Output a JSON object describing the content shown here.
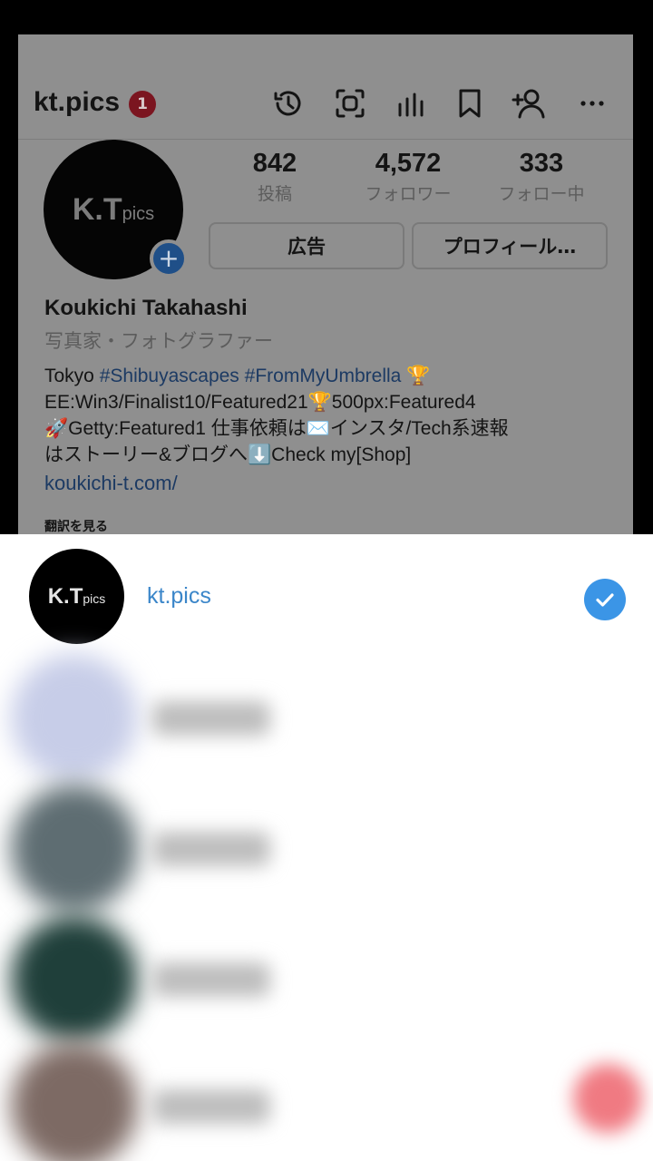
{
  "profile": {
    "username": "kt.pics",
    "notification_count": "1",
    "avatar_logo": {
      "main": "K.T",
      "sub": "pics"
    },
    "add_story_symbol": "+",
    "stats": [
      {
        "value": "842",
        "label": "投稿"
      },
      {
        "value": "4,572",
        "label": "フォロワー"
      },
      {
        "value": "333",
        "label": "フォロー中"
      }
    ],
    "buttons": {
      "ads": "広告",
      "profile": "プロフィール…"
    },
    "full_name": "Koukichi Takahashi",
    "category": "写真家・フォトグラファー",
    "bio": {
      "line1_prefix": "Tokyo ",
      "tag1": "#Shibuyascapes",
      "tag2": "#FromMyUmbrella",
      "line1_suffix": " 🏆",
      "line2": "EE:Win3/Finalist10/Featured21🏆500px:Featured4",
      "line3": "🚀Getty:Featured1 仕事依頼は✉️インスタ/Tech系速報",
      "line4": "はストーリー&ブログへ⬇️Check my[Shop]"
    },
    "website": "koukichi-t.com/",
    "translate": "翻訳を見る",
    "toolbar_icons": [
      "history-icon",
      "scan-icon",
      "insights-icon",
      "bookmark-icon",
      "add-user-icon",
      "more-icon"
    ]
  },
  "account_sheet": {
    "current_account": {
      "name": "kt.pics",
      "logo_main": "K.T",
      "logo_sub": "pics",
      "selected": true
    },
    "blurred_accounts": [
      {
        "avatar_color": "#c7cde8"
      },
      {
        "avatar_color": "#5e6d72"
      },
      {
        "avatar_color": "#1f3f3a"
      },
      {
        "avatar_color": "#7d6a64"
      }
    ],
    "accent_color": "#3b95e6"
  }
}
